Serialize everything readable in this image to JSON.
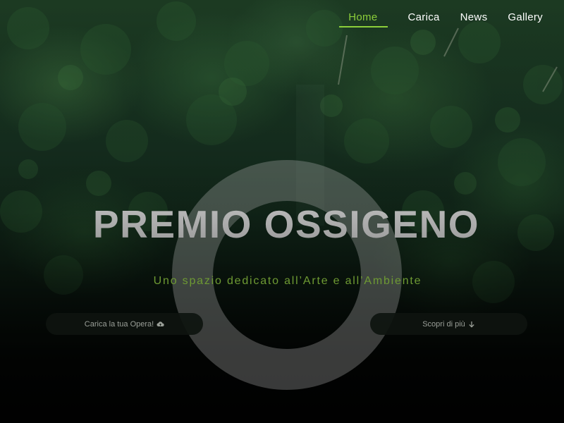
{
  "nav": {
    "items": [
      {
        "label": "Home",
        "active": true
      },
      {
        "label": "Carica",
        "active": false
      },
      {
        "label": "News",
        "active": false
      },
      {
        "label": "Gallery",
        "active": false
      }
    ]
  },
  "hero": {
    "title": "PREMIO OSSIGENO",
    "subtitle": "Uno spazio dedicato all’Arte e all’Ambiente",
    "cta_upload": {
      "label": "Carica la tua Opera!",
      "icon": "cloud-upload-icon"
    },
    "cta_discover": {
      "label": "Scopri di più",
      "icon": "arrow-down-icon"
    }
  },
  "colors": {
    "accent": "#8ccf3a",
    "subtitle": "#6e9a33",
    "title": "#a7a7a7",
    "button_bg": "#0e140f"
  }
}
